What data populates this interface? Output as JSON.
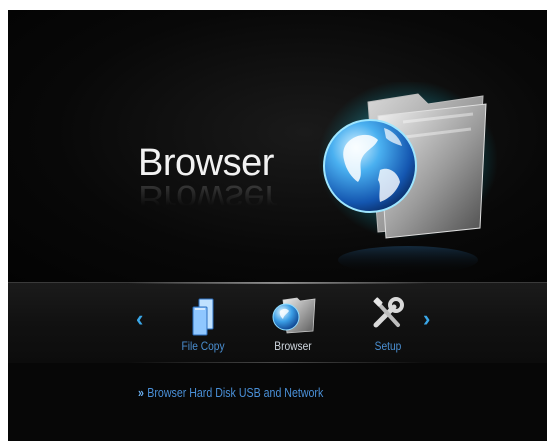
{
  "hero": {
    "title": "Browser"
  },
  "menu": {
    "items": [
      {
        "label": "File Copy",
        "icon": "file-copy-icon"
      },
      {
        "label": "Browser",
        "icon": "browser-folder-globe-icon"
      },
      {
        "label": "Setup",
        "icon": "setup-tools-icon"
      }
    ],
    "left_arrow": "‹",
    "right_arrow": "›"
  },
  "description": {
    "bullet": "»",
    "text": "Browser Hard Disk USB and Network"
  },
  "colors": {
    "accent_blue": "#3aa7e8",
    "label_blue": "#4a8ed0",
    "background": "#050505"
  }
}
